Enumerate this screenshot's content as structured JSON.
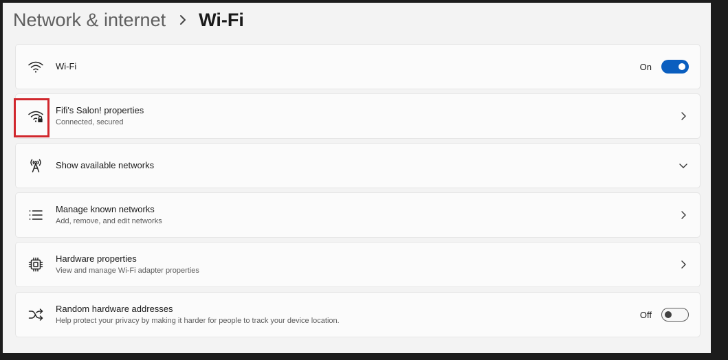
{
  "breadcrumb": {
    "parent": "Network & internet",
    "current": "Wi-Fi"
  },
  "cards": {
    "wifi": {
      "title": "Wi-Fi",
      "toggle_label": "On",
      "toggle_state": "on",
      "icon": "wifi-icon"
    },
    "network": {
      "title": "Fifi's Salon! properties",
      "subtitle": "Connected, secured",
      "icon": "wifi-lock-icon"
    },
    "available": {
      "title": "Show available networks",
      "icon": "antenna-icon"
    },
    "known": {
      "title": "Manage known networks",
      "subtitle": "Add, remove, and edit networks",
      "icon": "list-icon"
    },
    "hardware": {
      "title": "Hardware properties",
      "subtitle": "View and manage Wi-Fi adapter properties",
      "icon": "chip-icon"
    },
    "random": {
      "title": "Random hardware addresses",
      "subtitle": "Help protect your privacy by making it harder for people to track your device location.",
      "toggle_label": "Off",
      "toggle_state": "off",
      "icon": "shuffle-icon"
    }
  },
  "colors": {
    "accent": "#0a5ebf",
    "highlight": "#d1272d",
    "background": "#f3f3f3",
    "card": "#fbfbfb"
  }
}
